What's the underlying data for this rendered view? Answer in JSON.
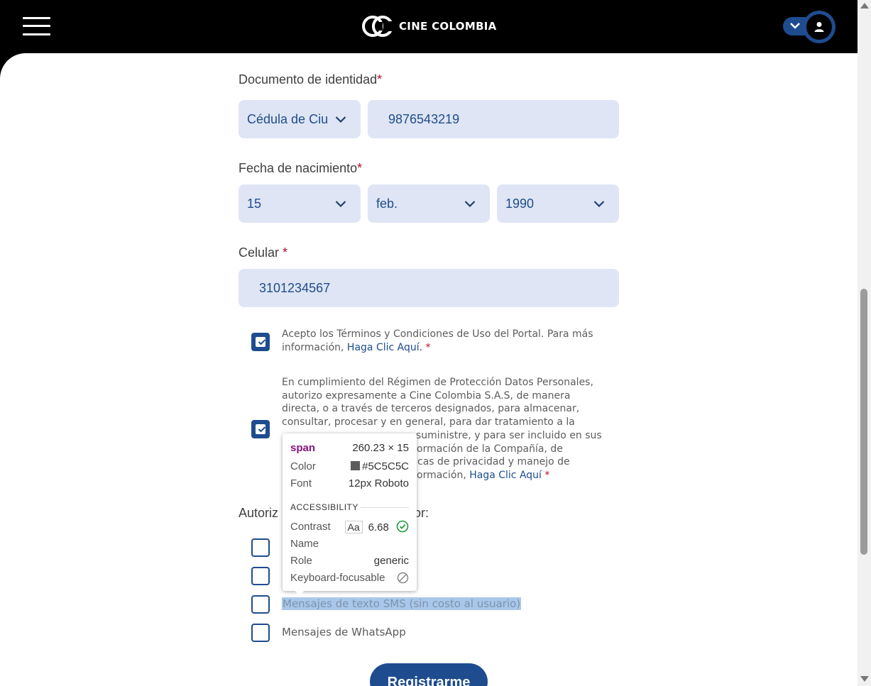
{
  "header": {
    "logo_text": "CINE COLOMBIA",
    "menu_icon": "hamburger-menu-icon",
    "user_icon": "user-icon"
  },
  "form": {
    "documento": {
      "label": "Documento de identidad",
      "required": "*",
      "type_value": "Cédula de Ciudadanía",
      "number_value": "9876543219"
    },
    "fecha": {
      "label": "Fecha de nacimiento",
      "required": "*",
      "day": "15",
      "month": "feb.",
      "year": "1990"
    },
    "celular": {
      "label": "Celular",
      "required": "*",
      "value": "3101234567"
    },
    "terms": {
      "text": "Acepto los Términos y Condiciones de Uso del Portal. Para más información,",
      "link": "Haga Clic Aquí.",
      "required": "*",
      "checked": true
    },
    "privacy": {
      "line1": "En cumplimiento del Régimen de Protección Datos Personales,",
      "line2": "autorizo expresamente a Cine Colombia S.A.S, de manera",
      "line3": "directa, o a través de terceros designados, para almacenar,",
      "line4": "consultar, procesar y en general, para dar tratamiento a la",
      "line5_right": "suministre, y para ser incluido en sus",
      "line6_right": "ormación de la Compañía, de",
      "line7_right": "cas de privacidad y manejo de",
      "line8_right": "ormación,",
      "link": "Haga Clic Aquí",
      "required": "*",
      "checked": true
    },
    "authorize_label_left": "Autoriz",
    "authorize_label_right": "or:",
    "preferences": [
      {
        "label": "",
        "checked": false
      },
      {
        "label": "",
        "checked": false
      },
      {
        "label": "Mensajes de texto SMS (sin costo al usuario)",
        "checked": false
      },
      {
        "label": "Mensajes de WhatsApp",
        "checked": false
      }
    ],
    "submit_label": "Registrarme"
  },
  "devtools_tooltip": {
    "tag": "span",
    "size": "260.23 × 15",
    "color_label": "Color",
    "color_value": "#5C5C5C",
    "font_label": "Font",
    "font_value": "12px Roboto",
    "section": "ACCESSIBILITY",
    "contrast_label": "Contrast",
    "contrast_aa": "Aa",
    "contrast_value": "6.68",
    "name_label": "Name",
    "name_value": "",
    "role_label": "Role",
    "role_value": "generic",
    "keyboard_label": "Keyboard-focusable"
  },
  "colors": {
    "brand_blue": "#1e4c8f",
    "field_bg": "#dfe5f4",
    "required_red": "#b3102a",
    "text_gray": "#5c5c5c"
  }
}
